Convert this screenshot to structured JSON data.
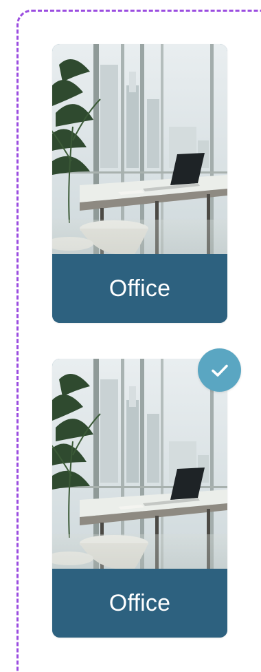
{
  "cards": [
    {
      "label": "Office",
      "image": "office-workspace-photo",
      "selected": false
    },
    {
      "label": "Office",
      "image": "office-workspace-photo",
      "selected": true
    }
  ],
  "selection": {
    "icon": "check-icon",
    "frame_color": "#9b4de0",
    "badge_color": "#5aa6c2"
  },
  "colors": {
    "label_band": "#2d617f",
    "label_text": "#ffffff"
  }
}
